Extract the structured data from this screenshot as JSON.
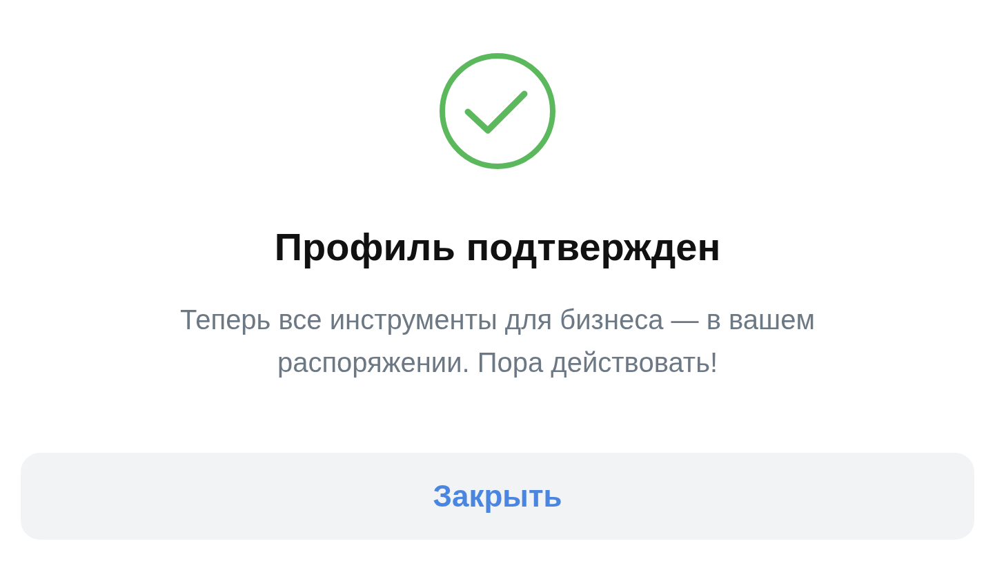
{
  "icon": {
    "kind": "success"
  },
  "title": "Профиль подтвержден",
  "message": "Теперь все инструменты для бизнеса — в вашем распоряжении. Пора действовать!",
  "button": "Закрыть"
}
